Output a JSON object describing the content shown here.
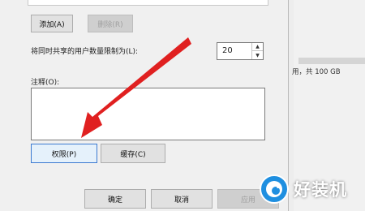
{
  "dialog": {
    "add_button": "添加(A)",
    "remove_button": "删除(R)",
    "user_limit_label": "将同时共享的用户数量限制为(L):",
    "user_limit_value": "20",
    "comment_label": "注释(O):",
    "comment_value": "",
    "permissions_button": "权限(P)",
    "caching_button": "缓存(C)",
    "ok_button": "确定",
    "cancel_button": "取消",
    "apply_button": "应用"
  },
  "background": {
    "storage_text": "用，共 100 GB"
  },
  "annotation": {
    "arrow_color": "#e02020"
  },
  "watermark": {
    "text": "好装机"
  }
}
